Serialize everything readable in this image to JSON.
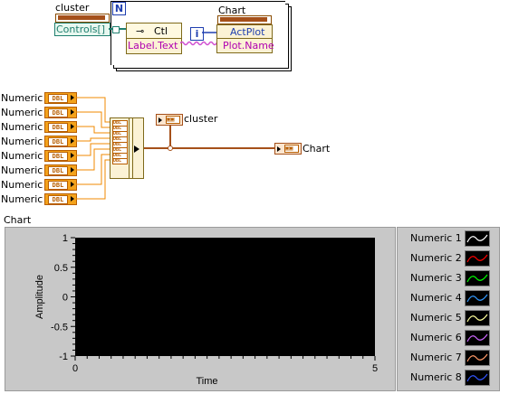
{
  "top_block": {
    "cluster_label": "cluster",
    "controls_label": "Controls[]",
    "loop_n": "N",
    "loop_i": "i",
    "ctl_label": "Ctl",
    "label_text": "Label.Text",
    "chart_label": "Chart",
    "actplot": "ActPlot",
    "plot_name": "Plot.Name"
  },
  "numerics": [
    "Numeric 1",
    "Numeric 2",
    "Numeric 3",
    "Numeric 4",
    "Numeric 5",
    "Numeric 6",
    "Numeric 7",
    "Numeric 8"
  ],
  "terminal_type": "DBL",
  "cluster_out_label": "cluster",
  "chart_out_label": "Chart",
  "chart_title": "Chart",
  "chart_data": {
    "type": "line",
    "title": "Chart",
    "xlabel": "Time",
    "ylabel": "Amplitude",
    "xlim": [
      0,
      5
    ],
    "ylim": [
      -1,
      1
    ],
    "xticks": [
      "0",
      "5"
    ],
    "yticks": [
      "1",
      "0.5",
      "0",
      "-0.5",
      "-1"
    ],
    "series": [
      {
        "name": "Numeric 1",
        "color": "#ffffff",
        "values": []
      },
      {
        "name": "Numeric 2",
        "color": "#ff0000",
        "values": []
      },
      {
        "name": "Numeric 3",
        "color": "#00ff00",
        "values": []
      },
      {
        "name": "Numeric 4",
        "color": "#3399ff",
        "values": []
      },
      {
        "name": "Numeric 5",
        "color": "#ffff99",
        "values": []
      },
      {
        "name": "Numeric 6",
        "color": "#cc66ff",
        "values": []
      },
      {
        "name": "Numeric 7",
        "color": "#ff9966",
        "values": []
      },
      {
        "name": "Numeric 8",
        "color": "#3355ff",
        "values": []
      }
    ],
    "legend": "right",
    "plot_background": "#000000"
  }
}
